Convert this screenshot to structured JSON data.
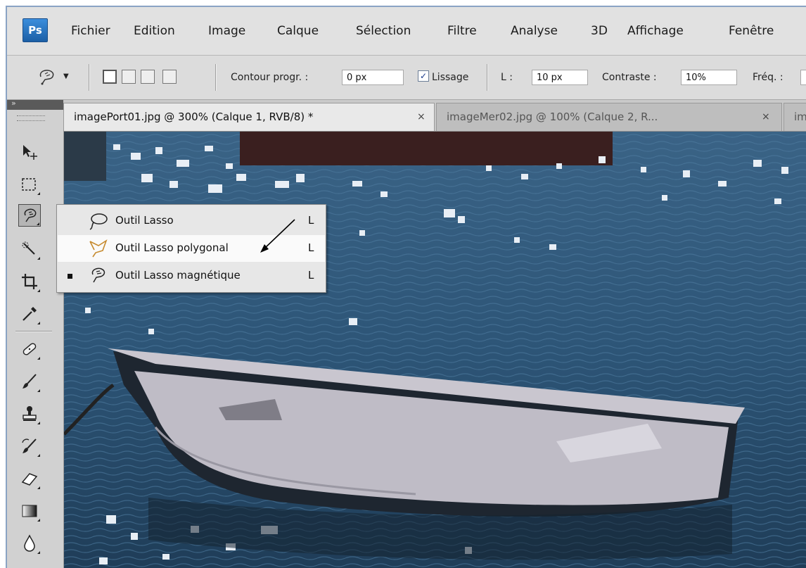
{
  "app": {
    "logo_text": "Ps",
    "accent": "#2b77c6"
  },
  "menu": {
    "items": [
      "Fichier",
      "Edition",
      "Image",
      "Calque",
      "Sélection",
      "Filtre",
      "Analyse",
      "3D",
      "Affichage",
      "Fenêtre"
    ]
  },
  "options": {
    "contour_label": "Contour progr. :",
    "contour_value": "0 px",
    "lissage_label": "Lissage",
    "lissage_checked": true,
    "width_label": "L :",
    "width_value": "10 px",
    "contrast_label": "Contraste :",
    "contrast_value": "10%",
    "freq_label": "Fréq. :"
  },
  "tabs": [
    {
      "label": "imagePort01.jpg @ 300% (Calque 1, RVB/8) *",
      "active": true
    },
    {
      "label": "imageMer02.jpg @ 100% (Calque 2, R...",
      "active": false
    },
    {
      "label": "im",
      "active": false
    }
  ],
  "tab_close_glyph": "×",
  "toolbox": {
    "collapse_glyph": "»",
    "tools": [
      "move-icon",
      "marquee-icon",
      "magnetic-lasso-icon",
      "quick-selection-icon",
      "crop-icon",
      "eyedropper-icon",
      "healing-brush-icon",
      "brush-icon",
      "clone-stamp-icon",
      "history-brush-icon",
      "eraser-icon",
      "gradient-icon",
      "blur-icon"
    ]
  },
  "flyout": {
    "items": [
      {
        "label": "Outil Lasso",
        "key": "L",
        "icon": "lasso-icon",
        "current": false,
        "highlighted": false
      },
      {
        "label": "Outil Lasso polygonal",
        "key": "L",
        "icon": "polygonal-lasso-icon",
        "current": false,
        "highlighted": true
      },
      {
        "label": "Outil Lasso magnétique",
        "key": "L",
        "icon": "magnetic-lasso-icon",
        "current": true,
        "highlighted": false
      }
    ]
  },
  "canvas": {
    "water_color": "#2f5678",
    "boat_color": "#c9c6cf"
  }
}
